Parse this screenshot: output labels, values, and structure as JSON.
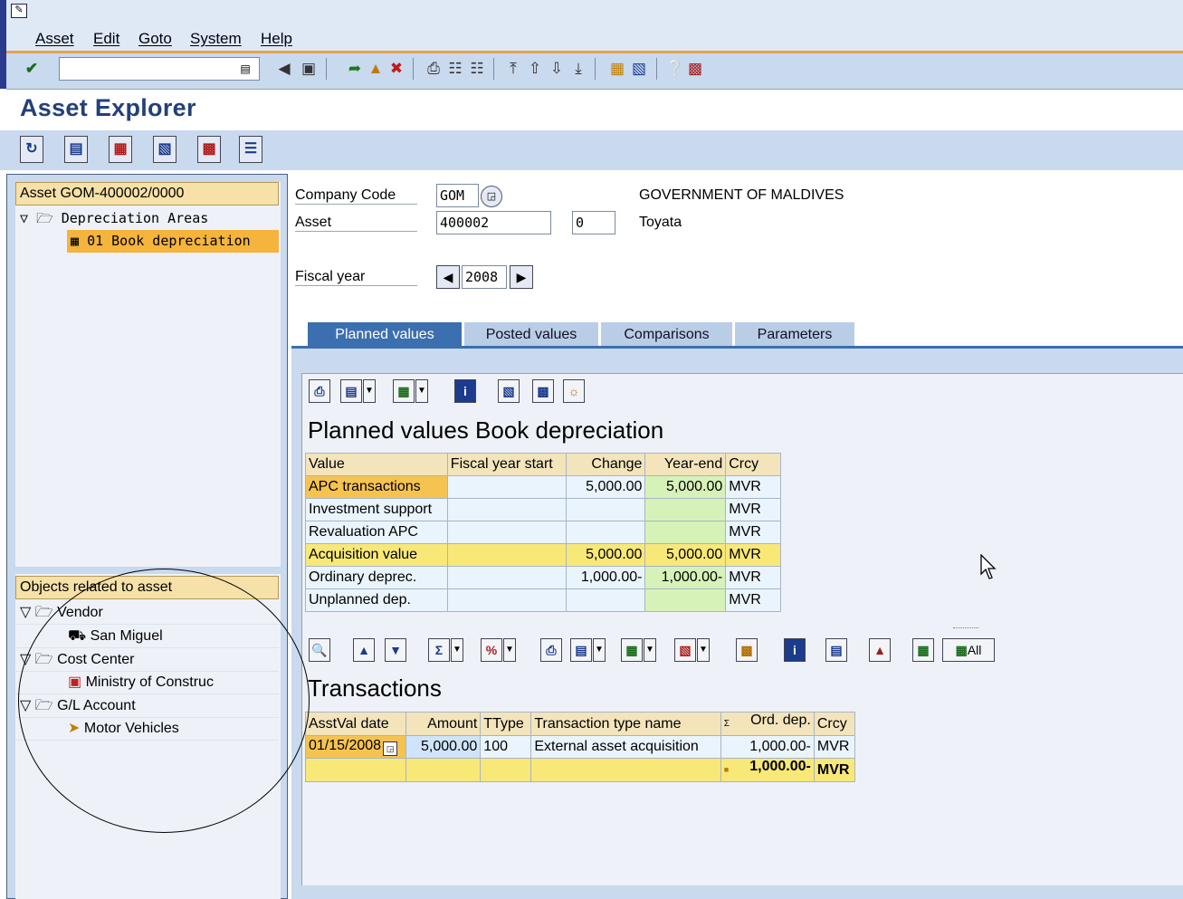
{
  "menu": {
    "items": [
      "Asset",
      "Edit",
      "Goto",
      "System",
      "Help"
    ]
  },
  "app": {
    "title": "Asset Explorer"
  },
  "tree": {
    "asset_header": "Asset GOM-400002/0000",
    "depreciation_areas": "Depreciation Areas",
    "selected_area": "01 Book depreciation",
    "objects_header": "Objects related to asset",
    "rows": [
      {
        "label": "Vendor",
        "level": 0
      },
      {
        "label": "San Miguel",
        "level": 1
      },
      {
        "label": "Cost Center",
        "level": 0
      },
      {
        "label": "Ministry of Construc",
        "level": 1
      },
      {
        "label": "G/L Account",
        "level": 0
      },
      {
        "label": "Motor Vehicles",
        "level": 1
      }
    ]
  },
  "header": {
    "company_code_label": "Company Code",
    "company_code_value": "GOM",
    "company_name": "GOVERNMENT OF MALDIVES",
    "asset_label": "Asset",
    "asset_value": "400002",
    "subnumber_value": "0",
    "asset_desc": "Toyata",
    "fiscal_year_label": "Fiscal year",
    "fiscal_year_value": "2008"
  },
  "tabs": [
    "Planned values",
    "Posted values",
    "Comparisons",
    "Parameters"
  ],
  "planned": {
    "title": "Planned values Book depreciation",
    "columns": [
      "Value",
      "Fiscal year start",
      "Change",
      "Year-end",
      "Crcy"
    ],
    "rows": [
      {
        "value": "APC transactions",
        "start": "",
        "change": "5,000.00",
        "yearend": "5,000.00",
        "crcy": "MVR"
      },
      {
        "value": "Investment support",
        "start": "",
        "change": "",
        "yearend": "",
        "crcy": "MVR"
      },
      {
        "value": "Revaluation APC",
        "start": "",
        "change": "",
        "yearend": "",
        "crcy": "MVR"
      },
      {
        "value": "Acquisition value",
        "start": "",
        "change": "5,000.00",
        "yearend": "5,000.00",
        "crcy": "MVR"
      },
      {
        "value": "Ordinary deprec.",
        "start": "",
        "change": "1,000.00-",
        "yearend": "1,000.00-",
        "crcy": "MVR"
      },
      {
        "value": "Unplanned dep.",
        "start": "",
        "change": "",
        "yearend": "",
        "crcy": "MVR"
      }
    ]
  },
  "transactions": {
    "title": "Transactions",
    "all_label": "All",
    "columns": [
      "AsstVal date",
      "Amount",
      "TType",
      "Transaction type name",
      "Ord. dep.",
      "Crcy"
    ],
    "sum_symbol": "Σ",
    "row": {
      "date": "01/15/2008",
      "amount": "5,000.00",
      "ttype": "100",
      "name": "External asset acquisition",
      "orddep": "1,000.00-",
      "crcy": "MVR"
    },
    "total": {
      "orddep": "1,000.00-",
      "crcy": "MVR"
    }
  }
}
